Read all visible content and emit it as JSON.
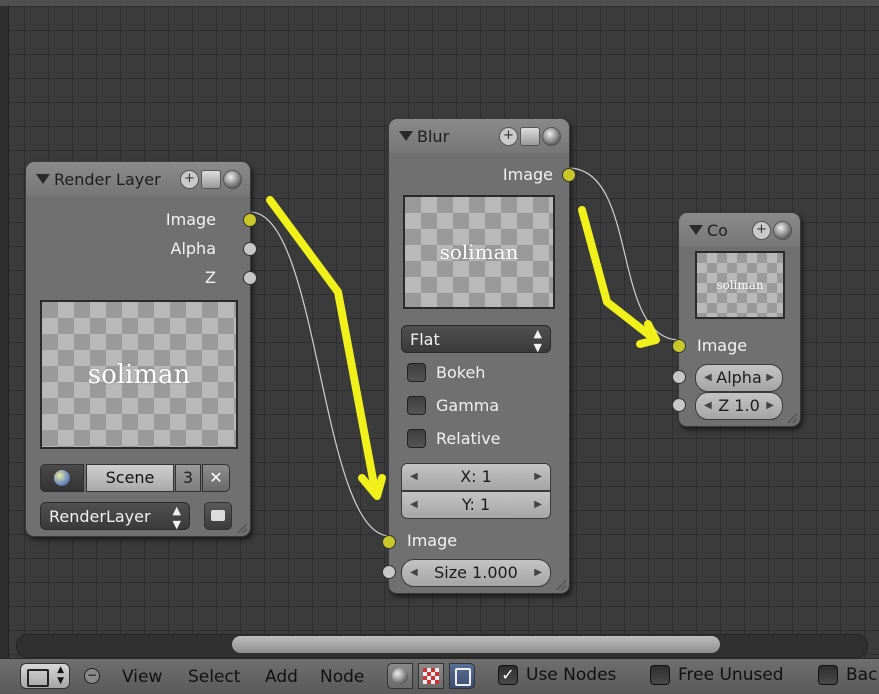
{
  "render_layer_node": {
    "title": "Render Layer",
    "outputs": [
      "Image",
      "Alpha",
      "Z"
    ],
    "preview_text": "soliman",
    "scene": {
      "label": "Scene",
      "count": "3"
    },
    "layer_select": "RenderLayer"
  },
  "blur_node": {
    "title": "Blur",
    "output": "Image",
    "preview_text": "soliman",
    "filter_type": "Flat",
    "checkboxes": [
      "Bokeh",
      "Gamma",
      "Relative"
    ],
    "x_field": "X: 1",
    "y_field": "Y: 1",
    "input_image": "Image",
    "size_field": "Size 1.000"
  },
  "composite_node": {
    "title": "Co",
    "preview_text": "soliman",
    "input_image": "Image",
    "alpha_field": "Alpha",
    "z_field": "Z 1.0"
  },
  "toolbar": {
    "view": "View",
    "select": "Select",
    "add": "Add",
    "node": "Node",
    "use_nodes": "Use Nodes",
    "free_unused": "Free Unused",
    "backdrop": "Bac"
  },
  "colors": {
    "annotation": "#f0f01a",
    "socket_image": "#c8c82a",
    "socket_value": "#c7c7c7"
  }
}
